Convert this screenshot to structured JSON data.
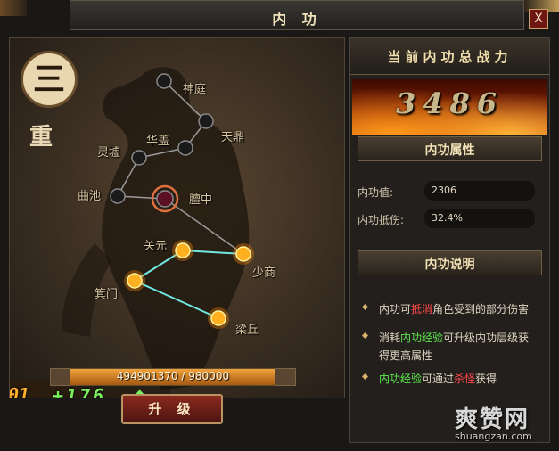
{
  "window": {
    "title": "内 功",
    "close_label": "X"
  },
  "tier": {
    "numeral": "三",
    "suffix": "重"
  },
  "acupoints": [
    {
      "name": "神庭",
      "active": false
    },
    {
      "name": "天鼎",
      "active": false
    },
    {
      "name": "华盖",
      "active": false
    },
    {
      "name": "灵墟",
      "active": false
    },
    {
      "name": "曲池",
      "active": false
    },
    {
      "name": "膻中",
      "active": false,
      "selected": true
    },
    {
      "name": "关元",
      "active": true
    },
    {
      "name": "少商",
      "active": true
    },
    {
      "name": "箕门",
      "active": true
    },
    {
      "name": "梁丘",
      "active": true
    }
  ],
  "power_gain": {
    "current_suffix": "01",
    "increase": "+176",
    "arrow": "⬆"
  },
  "experience": {
    "current": 494901370,
    "max": 980000,
    "display": "494901370 / 980000",
    "fill_fraction": 1.0
  },
  "upgrade_button": {
    "label": "升 级"
  },
  "right_panel": {
    "header": "当前内功总战力",
    "total_power": "3486",
    "attributes_title": "内功属性",
    "attributes": [
      {
        "label": "内功值:",
        "value": "2306"
      },
      {
        "label": "内功抵伤:",
        "value": "32.4%"
      }
    ],
    "description_title": "内功说明",
    "descriptions": [
      {
        "parts": [
          {
            "t": "内功可",
            "c": ""
          },
          {
            "t": "抵消",
            "c": "hl-red"
          },
          {
            "t": "角色受到的部分伤害",
            "c": ""
          }
        ]
      },
      {
        "parts": [
          {
            "t": "消耗",
            "c": ""
          },
          {
            "t": "内功经验",
            "c": "hl-green"
          },
          {
            "t": "可升级内功层级获得更高属性",
            "c": ""
          }
        ]
      },
      {
        "parts": [
          {
            "t": "内功经验",
            "c": "hl-green"
          },
          {
            "t": "可通过",
            "c": ""
          },
          {
            "t": "杀怪",
            "c": "hl-red"
          },
          {
            "t": "获得",
            "c": ""
          }
        ]
      }
    ]
  },
  "watermark": {
    "brand": "爽赞网",
    "url": "shuangzan.com"
  },
  "colors": {
    "active_node": "#ffb020",
    "inactive_node": "#1a1a1a",
    "active_link": "#6ee8e0",
    "inactive_link": "#9a9a9a",
    "accent_gold": "#d6b46d"
  }
}
